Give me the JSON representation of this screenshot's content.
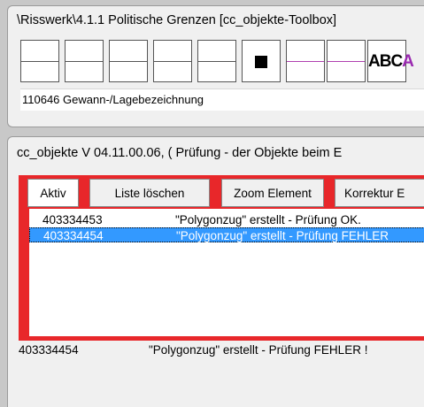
{
  "toolbox": {
    "title": "\\Risswerk\\4.1.1 Politische Grenzen  [cc_objekte-Toolbox]",
    "abc_label": "ABC",
    "abc_extra": "A",
    "status": "110646 Gewann-/Lagebezeichnung"
  },
  "cc_window": {
    "title": "cc_objekte V 04.11.00.06, ( Prüfung - der Objekte beim E",
    "tabs": [
      {
        "label": "Aktiv"
      },
      {
        "label": "Liste löschen"
      },
      {
        "label": "Zoom Element"
      },
      {
        "label": "Korrektur E"
      }
    ],
    "list": [
      {
        "id": "403334453",
        "message": "\"Polygonzug\" erstellt - Prüfung OK."
      },
      {
        "id": "403334454",
        "message": "\"Polygonzug\" erstellt - Prüfung FEHLER"
      }
    ],
    "detail": {
      "id": "403334454",
      "message": "\"Polygonzug\" erstellt - Prüfung FEHLER !"
    }
  },
  "colors": {
    "frame_red": "#e8272a",
    "selection_blue": "#3399ff",
    "purple_line": "#b040b0"
  }
}
